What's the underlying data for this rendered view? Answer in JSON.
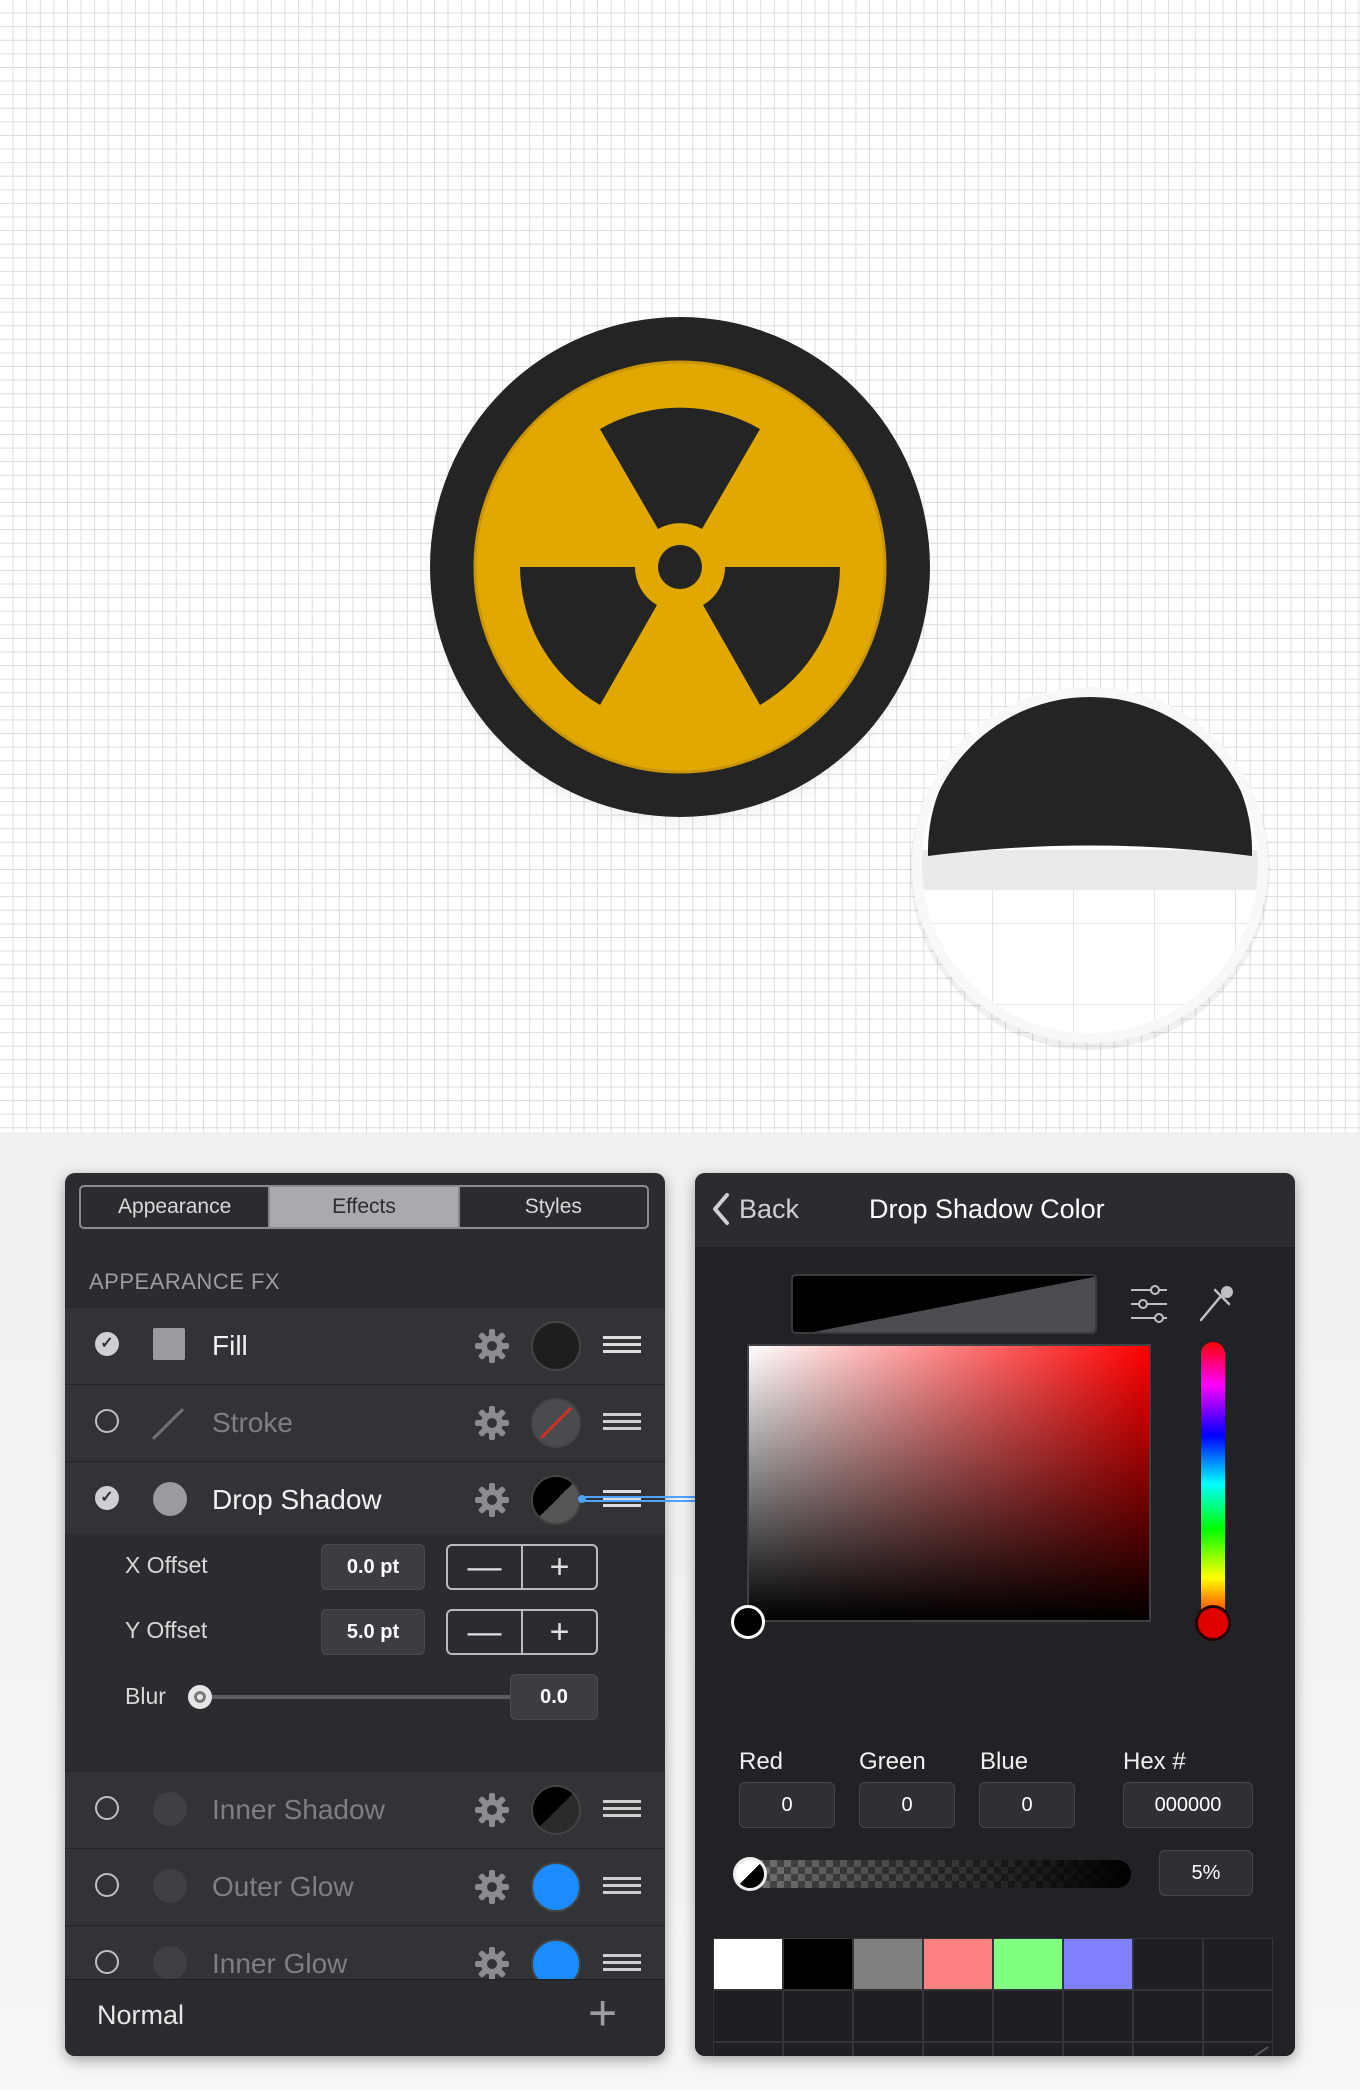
{
  "tabs": [
    "Appearance",
    "Effects",
    "Styles"
  ],
  "active_tab": "Effects",
  "section_header": "APPEARANCE FX",
  "effects": [
    {
      "label": "Fill",
      "enabled": true
    },
    {
      "label": "Stroke",
      "enabled": false
    },
    {
      "label": "Drop Shadow",
      "enabled": true
    },
    {
      "label": "Inner Shadow",
      "enabled": false
    },
    {
      "label": "Outer Glow",
      "enabled": false
    },
    {
      "label": "Inner Glow",
      "enabled": false
    }
  ],
  "drop_shadow": {
    "x_offset_label": "X Offset",
    "x_offset_value": "0.0 pt",
    "y_offset_label": "Y Offset",
    "y_offset_value": "5.0 pt",
    "blur_label": "Blur",
    "blur_value": "0.0",
    "blur_fraction": 0,
    "minus": "—",
    "plus": "+"
  },
  "blend_mode": "Normal",
  "add_symbol": "+",
  "color_panel": {
    "back_label": "Back",
    "title": "Drop Shadow Color",
    "channels": [
      {
        "label": "Red",
        "value": "0"
      },
      {
        "label": "Green",
        "value": "0"
      },
      {
        "label": "Blue",
        "value": "0"
      },
      {
        "label": "Hex #",
        "value": "000000"
      }
    ],
    "opacity_value": "5%",
    "palette": [
      "#ffffff",
      "#000000",
      "#808080",
      "#ff8080",
      "#80ff80",
      "#8080ff"
    ]
  },
  "colors": {
    "badge_yellow": "#e1a900",
    "badge_dark": "#242424",
    "panel_bg": "#2b2c2f",
    "accent_blue": "#1a8cff",
    "hue_handle": "#e00000"
  },
  "icons": {
    "check": "checkmark-icon",
    "gear": "gear-icon",
    "drag": "drag-handle-icon",
    "back": "chevron-left-icon",
    "sliders": "sliders-icon",
    "eyedropper": "eyedropper-icon"
  }
}
